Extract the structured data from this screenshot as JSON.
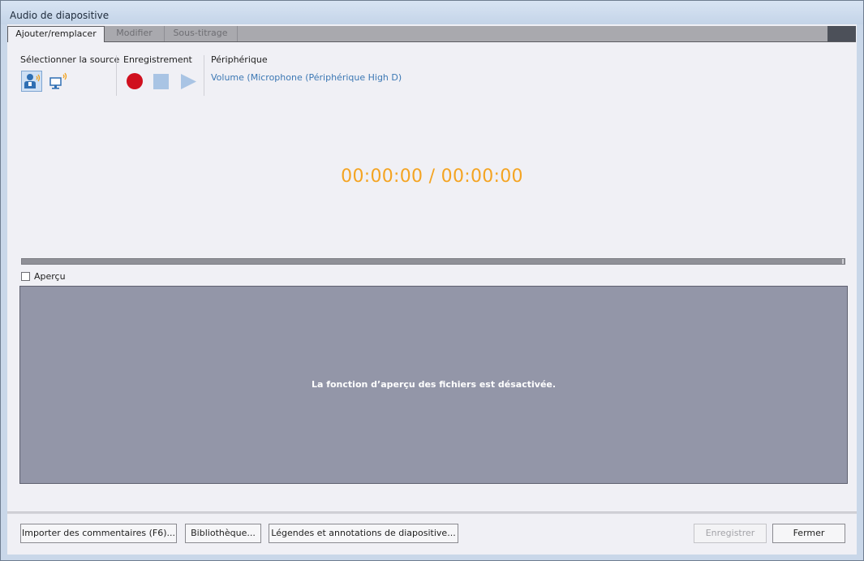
{
  "window": {
    "title": "Audio de diapositive"
  },
  "tabs": [
    {
      "label": "Ajouter/remplacer",
      "active": true
    },
    {
      "label": "Modifier",
      "active": false
    },
    {
      "label": "Sous-titrage",
      "active": false
    }
  ],
  "source": {
    "label": "Sélectionner la source",
    "selected": "microphone"
  },
  "recording": {
    "label": "Enregistrement"
  },
  "device": {
    "label": "Périphérique",
    "value": "Volume (Microphone (Périphérique High D)"
  },
  "timer": {
    "text": "00:00:00 / 00:00:00"
  },
  "preview": {
    "checkbox_label": "Aperçu",
    "checked": false,
    "message": "La fonction d’aperçu des fichiers est désactivée."
  },
  "footer": {
    "import_label": "Importer des commentaires (F6)...",
    "library_label": "Bibliothèque...",
    "captions_label": "Légendes et annotations de diapositive...",
    "save_label": "Enregistrer",
    "close_label": "Fermer"
  },
  "colors": {
    "accent": "#f4a422",
    "record": "#d0101e",
    "link": "#3c78b4",
    "preview_bg": "#9396a8"
  }
}
